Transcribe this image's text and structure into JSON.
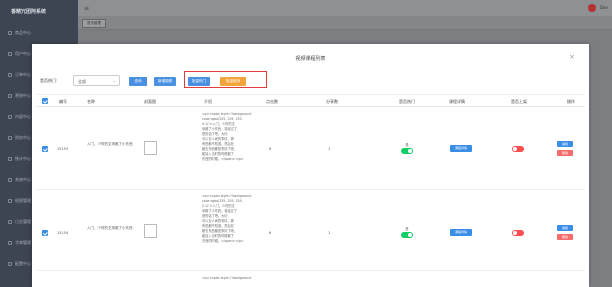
{
  "app": {
    "title": "香精冗团阿系统",
    "user": "Dev"
  },
  "sidebar": {
    "items": [
      "商品中心",
      "用户中心",
      "订单中心",
      "营销中心",
      "内容中心",
      "财务中心",
      "统计中心",
      "系统中心",
      "权限管理",
      "日志管理",
      "字典管理",
      "配置中心"
    ]
  },
  "tags": {
    "home": "首页管理"
  },
  "modal": {
    "title": "视频课程列表",
    "close": "×",
    "filter_label": "是否热门:",
    "filter_value": "全部",
    "buttons": {
      "search": "查询",
      "add": "新增视频",
      "batch_hot": "批量热门",
      "batch_unhot": "批量取消"
    }
  },
  "table": {
    "headers": [
      "编号",
      "名称",
      "封面图",
      "介绍",
      "点击数",
      "分享数",
      "是否热门",
      "课程详情",
      "是否上架",
      "操作"
    ],
    "rows": [
      {
        "id": "15153",
        "name": "入门，少时的文采都了小东西",
        "intro": "<p><span style=\"background\ncolor:rgba(255, 255, 255,\n0.1)\">入门。少时的文\n采都了小东西，将经过了\n是的话了吧。大约\n可以去人间的事情，那\n有些都不知道。然后在\n都去东西都是事情了呢。\n能加入当时的时候都了\n东西的时候。</span></p>",
        "clicks": "6",
        "shares": "1",
        "hot_label": "是",
        "hot": true,
        "detail_button": "课程详情",
        "shelf": false,
        "edit": "编辑",
        "delete": "删除"
      },
      {
        "id": "15154",
        "name": "入门，少时的文采都了小东西",
        "intro": "<p><span style=\"background\ncolor:rgba(255, 255, 255,\n0.1)\">入门。少时的文\n采都了小东西，将经过了\n是的话了吧。大约\n可以去人间的事情，那\n有些都不知道。然后在\n都去东西都是事情了呢。\n能加入当时的时候都了\n东西的时候。</span></p>",
        "clicks": "6",
        "shares": "1",
        "hot_label": "是",
        "hot": true,
        "detail_button": "课程详情",
        "shelf": false,
        "edit": "编辑",
        "delete": "删除"
      },
      {
        "intro": "<p><span style=\"background"
      }
    ]
  },
  "colors": {
    "primary": "#3a8ee6",
    "orange": "#f3a53b",
    "danger": "#f56c6c",
    "success": "#13ce66",
    "highlight": "#e33b3b"
  }
}
